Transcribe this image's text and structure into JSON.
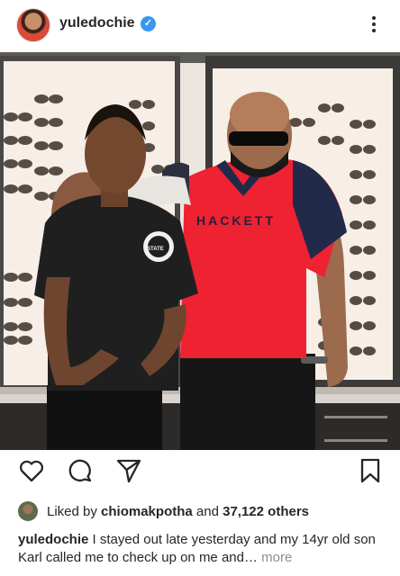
{
  "post": {
    "username": "yuledochie",
    "verified_mark": "✓"
  },
  "icons": {
    "more": "more-vertical-icon",
    "like": "heart-icon",
    "comment": "comment-icon",
    "share": "send-icon",
    "save": "bookmark-icon",
    "verified": "verified-badge-icon"
  },
  "photo": {
    "shirt_print": "HACKETT",
    "boy_shirt_emblem": "STATE"
  },
  "likes": {
    "prefix": "Liked by",
    "user": "chiomakpotha",
    "joiner": "and",
    "others": "37,122 others"
  },
  "caption": {
    "username": "yuledochie",
    "text": "I stayed out late yesterday and my 14yr old son Karl called me to check up on me and…",
    "more_label": "more"
  },
  "colors": {
    "accent_blue": "#3897f0",
    "text": "#262626",
    "muted": "#8e8e8e",
    "red_shirt": "#e0232f"
  }
}
